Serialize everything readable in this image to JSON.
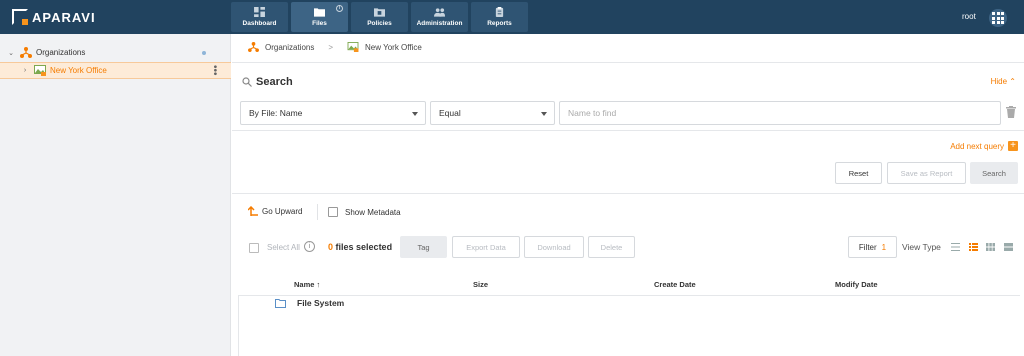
{
  "brand": {
    "logo_text": "APARAVI"
  },
  "nav": {
    "items": [
      {
        "label": "Dashboard",
        "icon": "dashboard-icon"
      },
      {
        "label": "Files",
        "icon": "folder-icon",
        "badge": "i"
      },
      {
        "label": "Policies",
        "icon": "policies-icon"
      },
      {
        "label": "Administration",
        "icon": "users-icon"
      },
      {
        "label": "Reports",
        "icon": "reports-icon"
      }
    ],
    "active": "Files"
  },
  "user": {
    "name": "root"
  },
  "sidebar": {
    "tree": [
      {
        "label": "Organizations",
        "icon": "organizations-icon",
        "expanded": true
      },
      {
        "label": "New York Office",
        "icon": "office-icon",
        "selected": true
      }
    ]
  },
  "breadcrumb": {
    "items": [
      "Organizations",
      "New York Office"
    ],
    "separator": ">"
  },
  "search": {
    "title": "Search",
    "hide_label": "Hide",
    "field_select": "By File: Name",
    "operator_select": "Equal",
    "value_placeholder": "Name to find",
    "add_next_query": "Add next query",
    "reset": "Reset",
    "save_as_report": "Save as Report",
    "search": "Search"
  },
  "toolbar": {
    "go_upward": "Go Upward",
    "show_metadata": "Show Metadata",
    "select_all": "Select All",
    "files_selected_count": "0",
    "files_selected_label": "files selected",
    "tag": "Tag",
    "export_data": "Export Data",
    "download": "Download",
    "delete": "Delete",
    "filter": "Filter",
    "filter_count": "1",
    "view_type": "View Type"
  },
  "table": {
    "columns": [
      "Name",
      "Size",
      "Create Date",
      "Modify Date"
    ],
    "sort_indicator": "↑",
    "rows": [
      {
        "name": "File System",
        "size": "",
        "create_date": "",
        "modify_date": ""
      }
    ]
  },
  "colors": {
    "topbar": "#21435f",
    "accent": "#f57c00",
    "selected_row_bg": "#fdebd8"
  }
}
